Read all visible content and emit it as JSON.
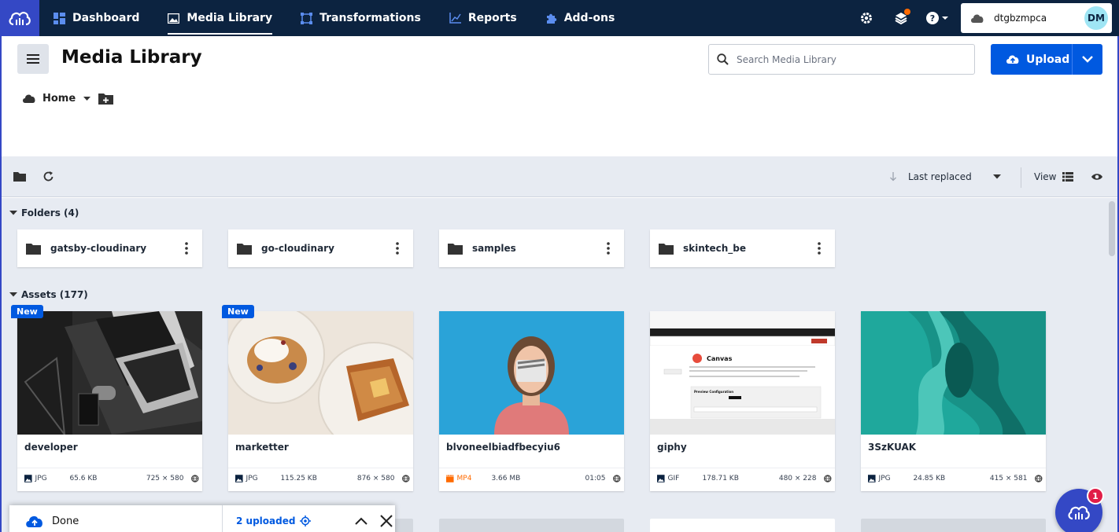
{
  "nav": {
    "items": [
      {
        "label": "Dashboard",
        "icon": "dashboard-icon"
      },
      {
        "label": "Media Library",
        "icon": "media-library-icon",
        "active": true
      },
      {
        "label": "Transformations",
        "icon": "transformations-icon"
      },
      {
        "label": "Reports",
        "icon": "reports-icon"
      },
      {
        "label": "Add-ons",
        "icon": "puzzle-icon"
      }
    ],
    "account_name": "dtgbzmpca",
    "avatar_initials": "DM",
    "notification_dot_color": "#ff6a00"
  },
  "header": {
    "title": "Media Library",
    "search_placeholder": "Search Media Library",
    "upload_label": "Upload",
    "breadcrumb_home": "Home"
  },
  "toolbar": {
    "sort_label": "Last replaced",
    "view_label": "View"
  },
  "folders": {
    "heading": "Folders (4)",
    "items": [
      {
        "name": "gatsby-cloudinary"
      },
      {
        "name": "go-cloudinary"
      },
      {
        "name": "samples"
      },
      {
        "name": "skintech_be"
      }
    ]
  },
  "assets": {
    "heading": "Assets (177)",
    "badge_new": "New",
    "items": [
      {
        "name": "developer",
        "type": "JPG",
        "size": "65.6 KB",
        "dims": "725 × 580",
        "is_new": true,
        "type_icon": "image-icon"
      },
      {
        "name": "marketter",
        "type": "JPG",
        "size": "115.25 KB",
        "dims": "876 × 580",
        "is_new": true,
        "type_icon": "image-icon"
      },
      {
        "name": "blvoneelbiadfbecyiu6",
        "type": "MP4",
        "size": "3.66 MB",
        "dims": "01:05",
        "is_new": false,
        "type_icon": "video-icon"
      },
      {
        "name": "giphy",
        "type": "GIF",
        "size": "178.71 KB",
        "dims": "480 × 228",
        "is_new": false,
        "type_icon": "image-icon"
      },
      {
        "name": "3SzKUAK",
        "type": "JPG",
        "size": "24.85 KB",
        "dims": "415 × 581",
        "is_new": false,
        "type_icon": "image-icon"
      }
    ]
  },
  "giphy_thumb": {
    "heading": "Canvas",
    "section": "Preview Configuration"
  },
  "upload_popup": {
    "status": "Done",
    "uploaded_text": "2 uploaded"
  },
  "chat": {
    "badge_count": "1"
  },
  "colors": {
    "nav_bg": "#0c2340",
    "brand": "#3448c5",
    "primary": "#0059e0",
    "content_bg": "#e7ebf2",
    "video_type": "#ff6a00"
  }
}
